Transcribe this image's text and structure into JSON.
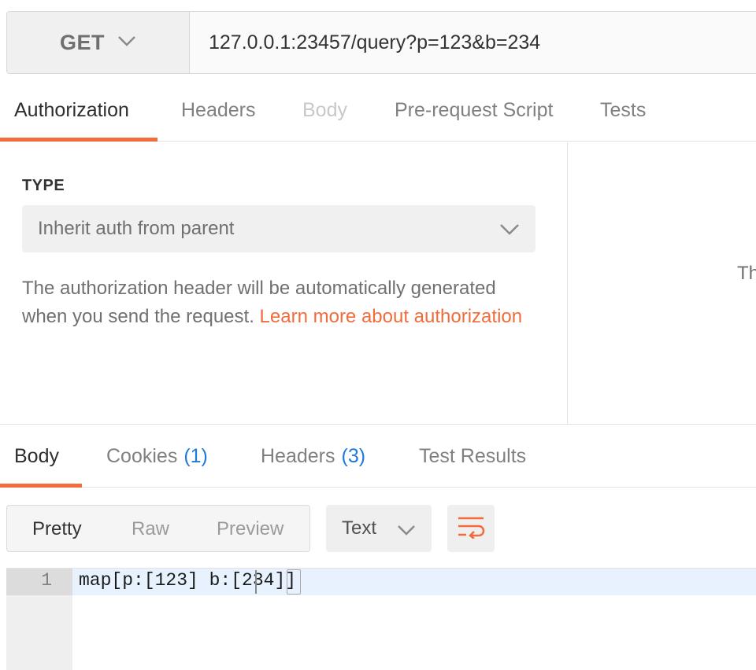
{
  "request": {
    "method": "GET",
    "url": "127.0.0.1:23457/query?p=123&b=234"
  },
  "request_tabs": [
    {
      "label": "Authorization",
      "state": "active"
    },
    {
      "label": "Headers",
      "state": "normal"
    },
    {
      "label": "Body",
      "state": "disabled"
    },
    {
      "label": "Pre-request Script",
      "state": "normal"
    },
    {
      "label": "Tests",
      "state": "normal"
    }
  ],
  "auth": {
    "type_label": "TYPE",
    "selected_type": "Inherit auth from parent",
    "description": "The authorization header will be automatically generated when you send the request.",
    "learn_more_link": "Learn more about authorization",
    "right_panel_fragment": "Th"
  },
  "response_tabs": {
    "body": "Body",
    "cookies": "Cookies",
    "cookies_count": "(1)",
    "headers": "Headers",
    "headers_count": "(3)",
    "test_results": "Test Results"
  },
  "view_modes": [
    "Pretty",
    "Raw",
    "Preview"
  ],
  "active_view_mode": "Pretty",
  "format_select": "Text",
  "editor": {
    "line_number": "1",
    "code": "map[p:[123] b:[234]]"
  },
  "colors": {
    "accent": "#f26b3a",
    "count_blue": "#1f7ad8",
    "active_line": "#e8f2fe"
  },
  "icons": {
    "method_dropdown": "chevron-down-icon",
    "type_dropdown": "chevron-down-icon",
    "format_dropdown": "chevron-down-icon",
    "wrap_toggle": "wrap-lines-icon"
  }
}
